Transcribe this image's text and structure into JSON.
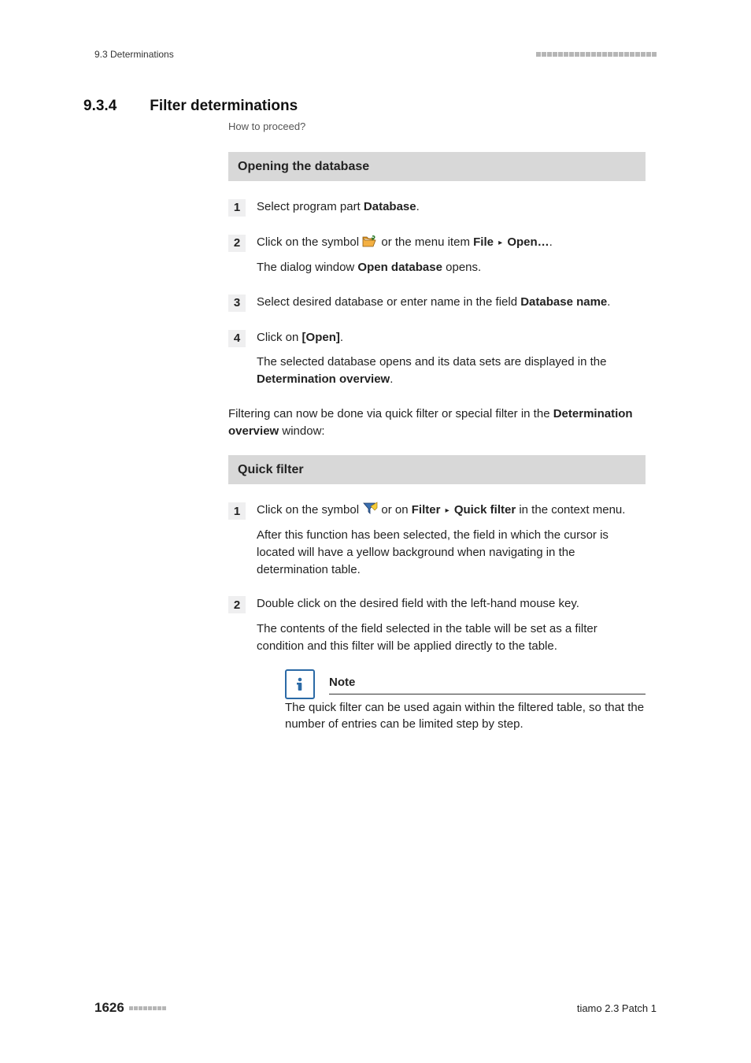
{
  "header": {
    "left": "9.3 Determinations"
  },
  "section": {
    "number": "9.3.4",
    "title": "Filter determinations",
    "how_to": "How to proceed?"
  },
  "openingBlock": {
    "title": "Opening the database",
    "steps": [
      {
        "num": "1",
        "lines": [
          {
            "text_before": "Select program part ",
            "bold": "Database",
            "text_after": "."
          }
        ]
      },
      {
        "num": "2",
        "lines": [
          {
            "text_before": "Click on the symbol ",
            "icon": "folder",
            "text_mid": " or the menu item ",
            "bold": "File",
            "tri": true,
            "bold2": "Open…",
            "text_after": "."
          },
          {
            "text_before": "The dialog window ",
            "bold": "Open database",
            "text_after": " opens."
          }
        ]
      },
      {
        "num": "3",
        "lines": [
          {
            "text_before": "Select desired database or enter name in the field ",
            "bold": "Database name",
            "text_after": "."
          }
        ]
      },
      {
        "num": "4",
        "lines": [
          {
            "text_before": "Click on ",
            "bold": "[Open]",
            "text_after": "."
          },
          {
            "text_before": "The selected database opens and its data sets are displayed in the ",
            "bold": "Determination overview",
            "text_after": "."
          }
        ]
      }
    ]
  },
  "transition": {
    "text_before": "Filtering can now be done via quick filter or special filter in the ",
    "bold": "Determination overview",
    "text_after": " window:"
  },
  "quickFilterBlock": {
    "title": "Quick filter",
    "steps": [
      {
        "num": "1",
        "lines": [
          {
            "text_before": "Click on the symbol ",
            "icon": "filter",
            "text_mid": " or on ",
            "bold": "Filter",
            "tri": true,
            "bold2": "Quick filter",
            "text_after": " in the context menu."
          },
          {
            "plain": "After this function has been selected, the field in which the cursor is located will have a yellow background when navigating in the determination table."
          }
        ]
      },
      {
        "num": "2",
        "lines": [
          {
            "plain": "Double click on the desired field with the left-hand mouse key."
          },
          {
            "plain": "The contents of the field selected in the table will be set as a filter condition and this filter will be applied directly to the table."
          }
        ],
        "note": {
          "title": "Note",
          "body": "The quick filter can be used again within the filtered table, so that the number of entries can be limited step by step."
        }
      }
    ]
  },
  "footer": {
    "page": "1626",
    "product": "tiamo 2.3 Patch 1"
  }
}
